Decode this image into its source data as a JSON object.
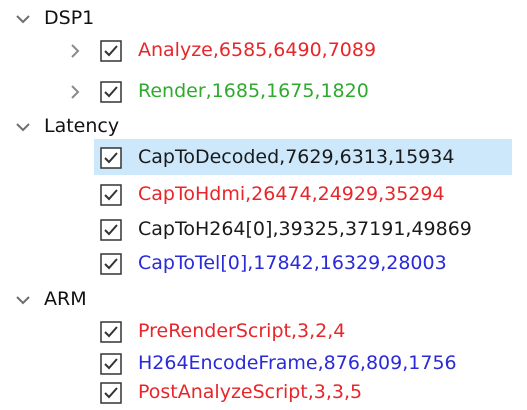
{
  "colors": {
    "red": "#e8262a",
    "green": "#2faa2f",
    "black": "#1a1a1a",
    "blue": "#2a2ad8",
    "chevron": "#7a7a7a",
    "selection": "#cde8fb"
  },
  "tree": {
    "groups": [
      {
        "label": "DSP1",
        "expanded": true,
        "items": [
          {
            "label": "Analyze,6585,6490,7089",
            "color": "#e8262a",
            "checked": true,
            "has_children": true,
            "expanded": false,
            "selected": false
          },
          {
            "label": "Render,1685,1675,1820",
            "color": "#2faa2f",
            "checked": true,
            "has_children": true,
            "expanded": false,
            "selected": false
          }
        ]
      },
      {
        "label": "Latency",
        "expanded": true,
        "items": [
          {
            "label": "CapToDecoded,7629,6313,15934",
            "color": "#1a1a1a",
            "checked": true,
            "has_children": false,
            "selected": true
          },
          {
            "label": "CapToHdmi,26474,24929,35294",
            "color": "#e8262a",
            "checked": true,
            "has_children": false,
            "selected": false
          },
          {
            "label": "CapToH264[0],39325,37191,49869",
            "color": "#1a1a1a",
            "checked": true,
            "has_children": false,
            "selected": false
          },
          {
            "label": "CapToTel[0],17842,16329,28003",
            "color": "#2a2ad8",
            "checked": true,
            "has_children": false,
            "selected": false
          }
        ]
      },
      {
        "label": "ARM",
        "expanded": true,
        "items": [
          {
            "label": "PreRenderScript,3,2,4",
            "color": "#e8262a",
            "checked": true,
            "has_children": false,
            "selected": false
          },
          {
            "label": "H264EncodeFrame,876,809,1756",
            "color": "#2a2ad8",
            "checked": true,
            "has_children": false,
            "selected": false
          },
          {
            "label": "PostAnalyzeScript,3,3,5",
            "color": "#e8262a",
            "checked": true,
            "has_children": false,
            "selected": false
          }
        ]
      }
    ]
  }
}
